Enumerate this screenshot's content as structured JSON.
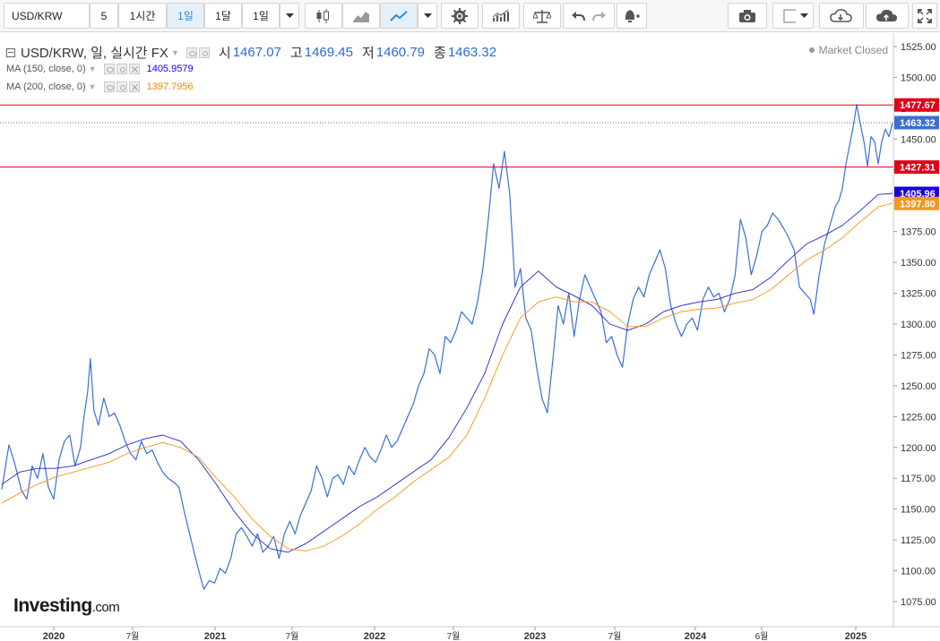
{
  "toolbar": {
    "symbol": "USD/KRW",
    "interval_5": "5",
    "interval_1h": "1시간",
    "interval_1d_active": "1일",
    "interval_1mo": "1달",
    "interval_1d_dropdown": "1일"
  },
  "legend": {
    "title": "USD/KRW, 일, 실시간 FX",
    "open_label": "시",
    "open": "1467.07",
    "high_label": "고",
    "high": "1469.45",
    "low_label": "저",
    "low": "1460.79",
    "close_label": "종",
    "close": "1463.32",
    "ma150_label": "MA (150, close, 0)",
    "ma150_value": "1405.9579",
    "ma200_label": "MA (200, close, 0)",
    "ma200_value": "1397.7956",
    "market_status": "Market Closed"
  },
  "watermark": {
    "brand": "Investing",
    "suffix": ".com"
  },
  "colors": {
    "price": "#3b6fd4",
    "ma150": "#2c1fc9",
    "ma200": "#f5961e",
    "hline": "#e0001a",
    "last_label": "#3b6fd4",
    "ma150_label": "#1a00d9",
    "ma200_label": "#f5961e"
  },
  "chart_data": {
    "type": "line",
    "symbol": "USD/KRW",
    "x_tick_labels": [
      "2020",
      "7월",
      "2021",
      "7월",
      "2022",
      "7월",
      "2023",
      "7월",
      "2024",
      "6월",
      "2025"
    ],
    "y_tick_labels": [
      "1075.00",
      "1100.00",
      "1125.00",
      "1150.00",
      "1175.00",
      "1200.00",
      "1225.00",
      "1250.00",
      "1275.00",
      "1300.00",
      "1325.00",
      "1350.00",
      "1375.00",
      "1400.00",
      "1425.00",
      "1450.00",
      "1475.00",
      "1500.00",
      "1525.00"
    ],
    "ylim": [
      1068,
      1528
    ],
    "grid": false,
    "horizontal_lines": [
      {
        "value": 1477.67,
        "label": "1477.67"
      },
      {
        "value": 1427.31,
        "label": "1427.31"
      }
    ],
    "last_value_labels": [
      {
        "value": 1463.32,
        "label": "1463.32",
        "series": "price"
      },
      {
        "value": 1405.96,
        "label": "1405.96",
        "series": "ma150"
      },
      {
        "value": 1397.8,
        "label": "1397.80",
        "series": "ma200"
      }
    ],
    "series": [
      {
        "name": "USD/KRW",
        "key": "price",
        "points": [
          [
            0,
            1166
          ],
          [
            8,
            1202
          ],
          [
            14,
            1188
          ],
          [
            22,
            1165
          ],
          [
            28,
            1158
          ],
          [
            34,
            1185
          ],
          [
            40,
            1175
          ],
          [
            46,
            1195
          ],
          [
            52,
            1168
          ],
          [
            58,
            1158
          ],
          [
            64,
            1190
          ],
          [
            70,
            1205
          ],
          [
            76,
            1210
          ],
          [
            82,
            1185
          ],
          [
            88,
            1200
          ],
          [
            92,
            1225
          ],
          [
            96,
            1245
          ],
          [
            99,
            1272
          ],
          [
            103,
            1230
          ],
          [
            108,
            1218
          ],
          [
            114,
            1240
          ],
          [
            120,
            1225
          ],
          [
            126,
            1228
          ],
          [
            132,
            1218
          ],
          [
            138,
            1205
          ],
          [
            144,
            1195
          ],
          [
            150,
            1190
          ],
          [
            156,
            1205
          ],
          [
            162,
            1195
          ],
          [
            168,
            1198
          ],
          [
            174,
            1188
          ],
          [
            180,
            1180
          ],
          [
            186,
            1175
          ],
          [
            192,
            1172
          ],
          [
            198,
            1168
          ],
          [
            204,
            1148
          ],
          [
            210,
            1130
          ],
          [
            216,
            1112
          ],
          [
            222,
            1095
          ],
          [
            226,
            1085
          ],
          [
            232,
            1092
          ],
          [
            238,
            1090
          ],
          [
            244,
            1102
          ],
          [
            250,
            1098
          ],
          [
            256,
            1110
          ],
          [
            262,
            1130
          ],
          [
            268,
            1135
          ],
          [
            274,
            1128
          ],
          [
            280,
            1120
          ],
          [
            286,
            1130
          ],
          [
            292,
            1115
          ],
          [
            298,
            1120
          ],
          [
            304,
            1128
          ],
          [
            310,
            1110
          ],
          [
            316,
            1130
          ],
          [
            322,
            1140
          ],
          [
            328,
            1130
          ],
          [
            334,
            1145
          ],
          [
            340,
            1155
          ],
          [
            346,
            1165
          ],
          [
            352,
            1185
          ],
          [
            358,
            1175
          ],
          [
            364,
            1160
          ],
          [
            370,
            1175
          ],
          [
            376,
            1178
          ],
          [
            382,
            1170
          ],
          [
            388,
            1185
          ],
          [
            394,
            1178
          ],
          [
            400,
            1190
          ],
          [
            406,
            1200
          ],
          [
            412,
            1192
          ],
          [
            418,
            1188
          ],
          [
            424,
            1198
          ],
          [
            430,
            1210
          ],
          [
            436,
            1200
          ],
          [
            442,
            1205
          ],
          [
            448,
            1215
          ],
          [
            454,
            1225
          ],
          [
            460,
            1235
          ],
          [
            466,
            1250
          ],
          [
            472,
            1260
          ],
          [
            478,
            1280
          ],
          [
            484,
            1275
          ],
          [
            490,
            1260
          ],
          [
            496,
            1290
          ],
          [
            502,
            1285
          ],
          [
            508,
            1295
          ],
          [
            514,
            1310
          ],
          [
            520,
            1305
          ],
          [
            526,
            1300
          ],
          [
            532,
            1318
          ],
          [
            538,
            1345
          ],
          [
            544,
            1385
          ],
          [
            550,
            1430
          ],
          [
            556,
            1410
          ],
          [
            562,
            1440
          ],
          [
            568,
            1405
          ],
          [
            574,
            1330
          ],
          [
            580,
            1345
          ],
          [
            586,
            1305
          ],
          [
            592,
            1295
          ],
          [
            598,
            1265
          ],
          [
            604,
            1240
          ],
          [
            610,
            1228
          ],
          [
            616,
            1270
          ],
          [
            622,
            1315
          ],
          [
            628,
            1300
          ],
          [
            634,
            1325
          ],
          [
            640,
            1290
          ],
          [
            646,
            1320
          ],
          [
            652,
            1340
          ],
          [
            658,
            1330
          ],
          [
            664,
            1320
          ],
          [
            670,
            1310
          ],
          [
            676,
            1285
          ],
          [
            682,
            1290
          ],
          [
            688,
            1275
          ],
          [
            694,
            1265
          ],
          [
            700,
            1300
          ],
          [
            706,
            1320
          ],
          [
            712,
            1330
          ],
          [
            718,
            1322
          ],
          [
            724,
            1340
          ],
          [
            730,
            1350
          ],
          [
            736,
            1360
          ],
          [
            742,
            1345
          ],
          [
            748,
            1315
          ],
          [
            754,
            1300
          ],
          [
            760,
            1290
          ],
          [
            766,
            1300
          ],
          [
            772,
            1305
          ],
          [
            778,
            1295
          ],
          [
            784,
            1320
          ],
          [
            790,
            1330
          ],
          [
            796,
            1322
          ],
          [
            802,
            1325
          ],
          [
            808,
            1310
          ],
          [
            814,
            1320
          ],
          [
            820,
            1340
          ],
          [
            826,
            1385
          ],
          [
            832,
            1370
          ],
          [
            838,
            1340
          ],
          [
            844,
            1355
          ],
          [
            850,
            1375
          ],
          [
            856,
            1380
          ],
          [
            862,
            1390
          ],
          [
            868,
            1385
          ],
          [
            874,
            1378
          ],
          [
            880,
            1370
          ],
          [
            886,
            1360
          ],
          [
            892,
            1330
          ],
          [
            898,
            1325
          ],
          [
            904,
            1320
          ],
          [
            908,
            1308
          ],
          [
            914,
            1340
          ],
          [
            920,
            1365
          ],
          [
            926,
            1380
          ],
          [
            932,
            1395
          ],
          [
            936,
            1400
          ],
          [
            940,
            1410
          ],
          [
            944,
            1430
          ],
          [
            948,
            1445
          ],
          [
            952,
            1460
          ],
          [
            956,
            1478
          ],
          [
            960,
            1462
          ],
          [
            964,
            1448
          ],
          [
            968,
            1428
          ],
          [
            972,
            1452
          ],
          [
            976,
            1448
          ],
          [
            980,
            1430
          ],
          [
            984,
            1448
          ],
          [
            988,
            1458
          ],
          [
            992,
            1452
          ],
          [
            996,
            1463
          ]
        ]
      },
      {
        "name": "MA (150, close, 0)",
        "key": "ma150",
        "points": [
          [
            0,
            1170
          ],
          [
            20,
            1180
          ],
          [
            40,
            1183
          ],
          [
            60,
            1183
          ],
          [
            80,
            1185
          ],
          [
            100,
            1190
          ],
          [
            120,
            1195
          ],
          [
            140,
            1202
          ],
          [
            160,
            1207
          ],
          [
            180,
            1210
          ],
          [
            200,
            1205
          ],
          [
            220,
            1190
          ],
          [
            240,
            1170
          ],
          [
            260,
            1148
          ],
          [
            280,
            1130
          ],
          [
            300,
            1118
          ],
          [
            320,
            1115
          ],
          [
            340,
            1122
          ],
          [
            360,
            1132
          ],
          [
            380,
            1142
          ],
          [
            400,
            1152
          ],
          [
            420,
            1160
          ],
          [
            440,
            1170
          ],
          [
            460,
            1180
          ],
          [
            480,
            1190
          ],
          [
            500,
            1208
          ],
          [
            520,
            1232
          ],
          [
            540,
            1260
          ],
          [
            560,
            1300
          ],
          [
            580,
            1330
          ],
          [
            600,
            1343
          ],
          [
            620,
            1330
          ],
          [
            640,
            1323
          ],
          [
            660,
            1315
          ],
          [
            680,
            1300
          ],
          [
            700,
            1295
          ],
          [
            720,
            1300
          ],
          [
            740,
            1310
          ],
          [
            760,
            1315
          ],
          [
            780,
            1318
          ],
          [
            800,
            1320
          ],
          [
            820,
            1325
          ],
          [
            840,
            1328
          ],
          [
            860,
            1338
          ],
          [
            880,
            1352
          ],
          [
            900,
            1365
          ],
          [
            920,
            1372
          ],
          [
            940,
            1380
          ],
          [
            960,
            1392
          ],
          [
            980,
            1405
          ],
          [
            996,
            1406
          ]
        ]
      },
      {
        "name": "MA (200, close, 0)",
        "key": "ma200",
        "points": [
          [
            0,
            1155
          ],
          [
            20,
            1163
          ],
          [
            40,
            1170
          ],
          [
            60,
            1176
          ],
          [
            80,
            1180
          ],
          [
            100,
            1184
          ],
          [
            120,
            1188
          ],
          [
            140,
            1195
          ],
          [
            160,
            1200
          ],
          [
            180,
            1204
          ],
          [
            200,
            1200
          ],
          [
            220,
            1192
          ],
          [
            240,
            1175
          ],
          [
            260,
            1160
          ],
          [
            280,
            1142
          ],
          [
            300,
            1128
          ],
          [
            320,
            1118
          ],
          [
            340,
            1116
          ],
          [
            360,
            1120
          ],
          [
            380,
            1128
          ],
          [
            400,
            1138
          ],
          [
            420,
            1150
          ],
          [
            440,
            1160
          ],
          [
            460,
            1172
          ],
          [
            480,
            1182
          ],
          [
            500,
            1192
          ],
          [
            520,
            1210
          ],
          [
            540,
            1240
          ],
          [
            560,
            1275
          ],
          [
            580,
            1305
          ],
          [
            600,
            1318
          ],
          [
            620,
            1322
          ],
          [
            640,
            1318
          ],
          [
            660,
            1318
          ],
          [
            680,
            1310
          ],
          [
            700,
            1298
          ],
          [
            720,
            1298
          ],
          [
            740,
            1305
          ],
          [
            760,
            1310
          ],
          [
            780,
            1312
          ],
          [
            800,
            1313
          ],
          [
            820,
            1317
          ],
          [
            840,
            1320
          ],
          [
            860,
            1328
          ],
          [
            880,
            1340
          ],
          [
            900,
            1352
          ],
          [
            920,
            1360
          ],
          [
            940,
            1370
          ],
          [
            960,
            1383
          ],
          [
            980,
            1395
          ],
          [
            996,
            1398
          ]
        ]
      }
    ]
  }
}
